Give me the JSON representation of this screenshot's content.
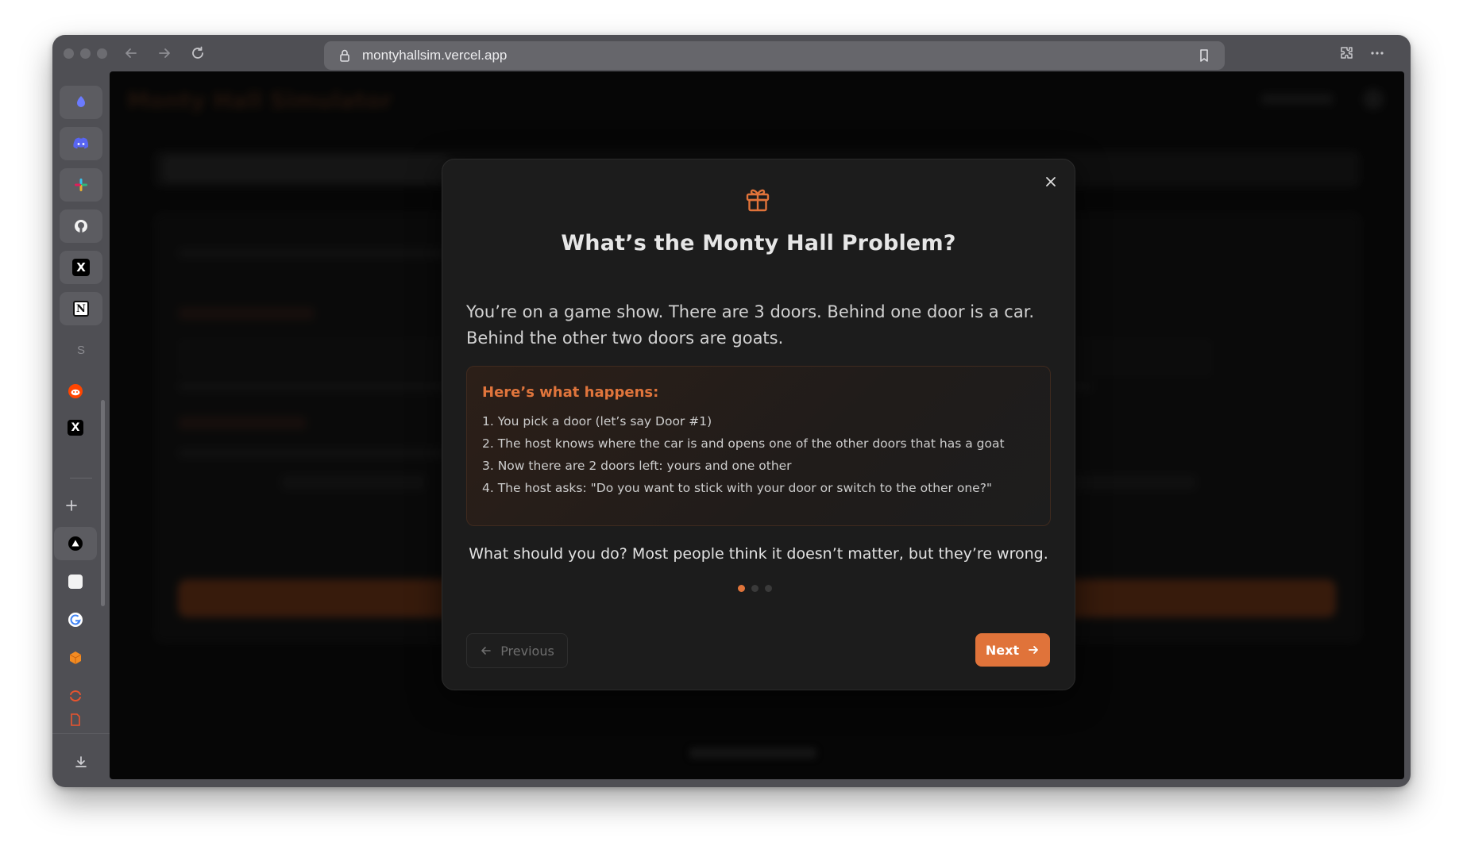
{
  "browser": {
    "url": "montyhallsim.vercel.app",
    "icons": {
      "back": "arrow-left-icon",
      "forward": "arrow-right-icon",
      "reload": "reload-icon",
      "lock": "lock-icon",
      "bookmark": "bookmark-icon",
      "extensions": "puzzle-icon",
      "more": "more-icon"
    }
  },
  "sidebar": {
    "items": [
      {
        "name": "sidebar-item-app-1",
        "glyph": "●",
        "color": "#6b7bff"
      },
      {
        "name": "sidebar-item-discord",
        "glyph": "◉",
        "color": "#5865f2"
      },
      {
        "name": "sidebar-item-slack",
        "glyph": "✚",
        "color": "#e8a13a"
      },
      {
        "name": "sidebar-item-github",
        "glyph": "◯",
        "color": "#ffffff"
      },
      {
        "name": "sidebar-item-x",
        "glyph": "𝕏",
        "color": "#ffffff"
      },
      {
        "name": "sidebar-item-notion",
        "glyph": "N",
        "color": "#ffffff"
      },
      {
        "name": "sidebar-item-s",
        "glyph": "S",
        "color": "#8a8a8f"
      },
      {
        "name": "sidebar-item-reddit",
        "glyph": "●",
        "color": "#ff4500"
      },
      {
        "name": "sidebar-item-x-2",
        "glyph": "𝕏",
        "color": "#ffffff"
      }
    ],
    "pinned": [
      {
        "name": "sidebar-item-vercel",
        "glyph": "▲",
        "color": "#ffffff"
      },
      {
        "name": "sidebar-item-notes",
        "glyph": "■",
        "color": "#ffffff"
      },
      {
        "name": "sidebar-item-google",
        "glyph": "G",
        "color": "#ea4335"
      },
      {
        "name": "sidebar-item-box",
        "glyph": "⬢",
        "color": "#f28b22"
      },
      {
        "name": "sidebar-item-loader",
        "glyph": "◠",
        "color": "#e8542e"
      },
      {
        "name": "sidebar-item-file",
        "glyph": "▭",
        "color": "#e8542e"
      }
    ]
  },
  "background_app": {
    "title": "Monty Hall Simulator"
  },
  "modal": {
    "icon": "gift-icon",
    "title": "What’s the Monty Hall Problem?",
    "intro": "You’re on a game show. There are 3 doors. Behind one door is a car. Behind the other two doors are goats.",
    "steps_heading": "Here’s what happens:",
    "steps": [
      "1. You pick a door (let’s say Door #1)",
      "2. The host knows where the car is and opens one of the other doors that has a goat",
      "3. Now there are 2 doors left: yours and one other",
      "4. The host asks: \"Do you want to stick with your door or switch to the other one?\""
    ],
    "question": "What should you do? Most people think it doesn’t matter, but they’re wrong.",
    "page_current": 1,
    "page_total": 3,
    "prev_label": "Previous",
    "next_label": "Next",
    "accent_color": "#e0733a"
  }
}
